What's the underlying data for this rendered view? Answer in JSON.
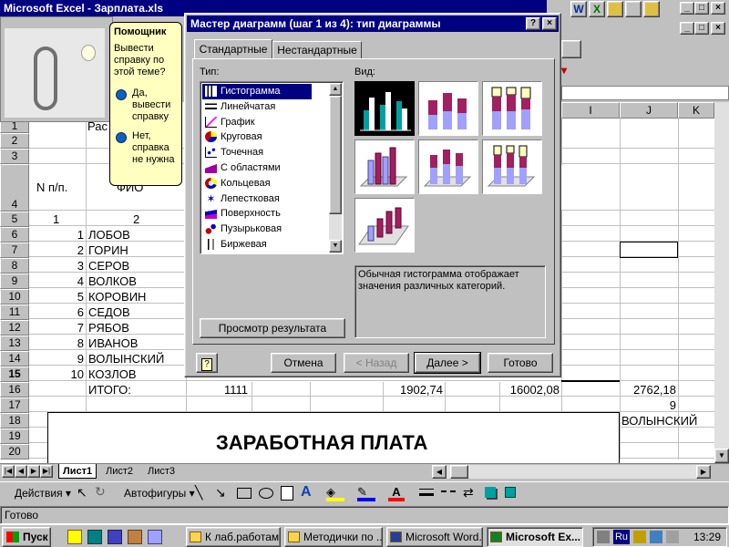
{
  "app": {
    "title": "Microsoft Excel - Зарплата.xls",
    "status": "Готово"
  },
  "assistant": {
    "title": "Помощник",
    "question": "Вывести справку по этой теме?",
    "option_yes": "Да, вывести справку",
    "option_no": "Нет, справка не нужна"
  },
  "dialog": {
    "title": "Мастер диаграмм (шаг 1 из 4): тип диаграммы",
    "help": "?",
    "close": "×",
    "tabs": [
      "Стандартные",
      "Нестандартные"
    ],
    "type_label": "Тип:",
    "view_label": "Вид:",
    "types": [
      "Гистограмма",
      "Линейчатая",
      "График",
      "Круговая",
      "Точечная",
      "С областями",
      "Кольцевая",
      "Лепестковая",
      "Поверхность",
      "Пузырьковая",
      "Биржевая"
    ],
    "description": "Обычная гистограмма отображает значения различных категорий.",
    "preview_button": "Просмотр результата",
    "buttons": {
      "cancel": "Отмена",
      "back": "< Назад",
      "next": "Далее >",
      "finish": "Готово"
    }
  },
  "sheet": {
    "columns": [
      "I",
      "J",
      "K"
    ],
    "rows": [
      "1",
      "2",
      "3",
      "4",
      "5",
      "6",
      "7",
      "8",
      "9",
      "10",
      "11",
      "12",
      "13",
      "14",
      "15",
      "16",
      "17",
      "18",
      "19",
      "20"
    ],
    "header_npp": "N п/п.",
    "header_fio": "ФИО",
    "header_fio_partial": "Рас",
    "col_num_1": "1",
    "col_num_2": "2",
    "employees": [
      {
        "n": "1",
        "name": "ЛОБОВ"
      },
      {
        "n": "2",
        "name": "ГОРИН"
      },
      {
        "n": "3",
        "name": "СЕРОВ"
      },
      {
        "n": "4",
        "name": "ВОЛКОВ"
      },
      {
        "n": "5",
        "name": "КОРОВИН"
      },
      {
        "n": "6",
        "name": "СЕДОВ"
      },
      {
        "n": "7",
        "name": "РЯБОВ"
      },
      {
        "n": "8",
        "name": "ИВАНОВ"
      },
      {
        "n": "9",
        "name": "ВОЛЫНСКИЙ"
      },
      {
        "n": "10",
        "name": "КОЗЛОВ"
      }
    ],
    "total_label": "ИТОГО:",
    "total_vals": [
      "1111",
      "1902,74",
      "16002,08",
      "2762,18"
    ],
    "r17_j": "9",
    "r18_j": "ВОЛЫНСКИЙ",
    "chart_title": "ЗАРАБОТНАЯ ПЛАТА",
    "sheet_tabs": [
      "Лист1",
      "Лист2",
      "Лист3"
    ]
  },
  "drawing_toolbar": {
    "actions": "Действия",
    "autoshapes": "Автофигуры"
  },
  "taskbar": {
    "start": "Пуск",
    "items": [
      "К лаб.работам",
      "Методички по ...",
      "Microsoft Word...",
      "Microsoft Ex..."
    ],
    "lang": "Ru",
    "time": "13:29"
  }
}
